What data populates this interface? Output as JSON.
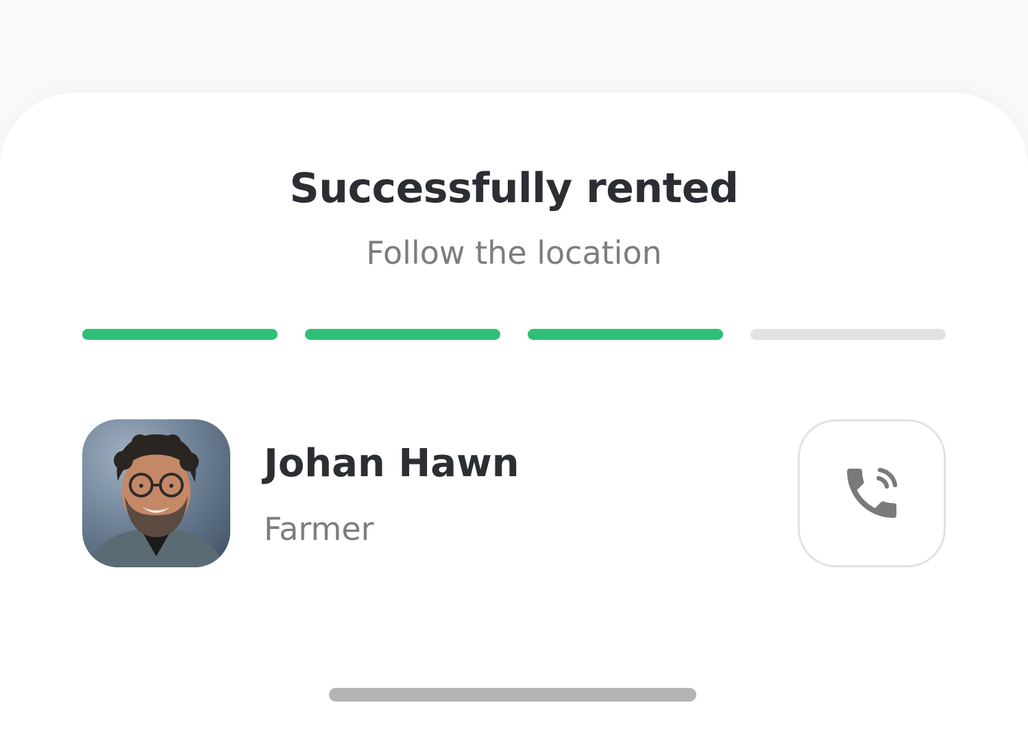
{
  "sheet": {
    "title": "Successfully rented",
    "subtitle": "Follow the location"
  },
  "progress": {
    "total_steps": 4,
    "completed_steps": 3,
    "active_color": "#2fbf78",
    "inactive_color": "#e2e2e2"
  },
  "contact": {
    "name": "Johan Hawn",
    "role": "Farmer",
    "call_icon": "phone-call-icon"
  },
  "colors": {
    "text_primary": "#2b2e33",
    "text_secondary": "#7d7d7d"
  }
}
